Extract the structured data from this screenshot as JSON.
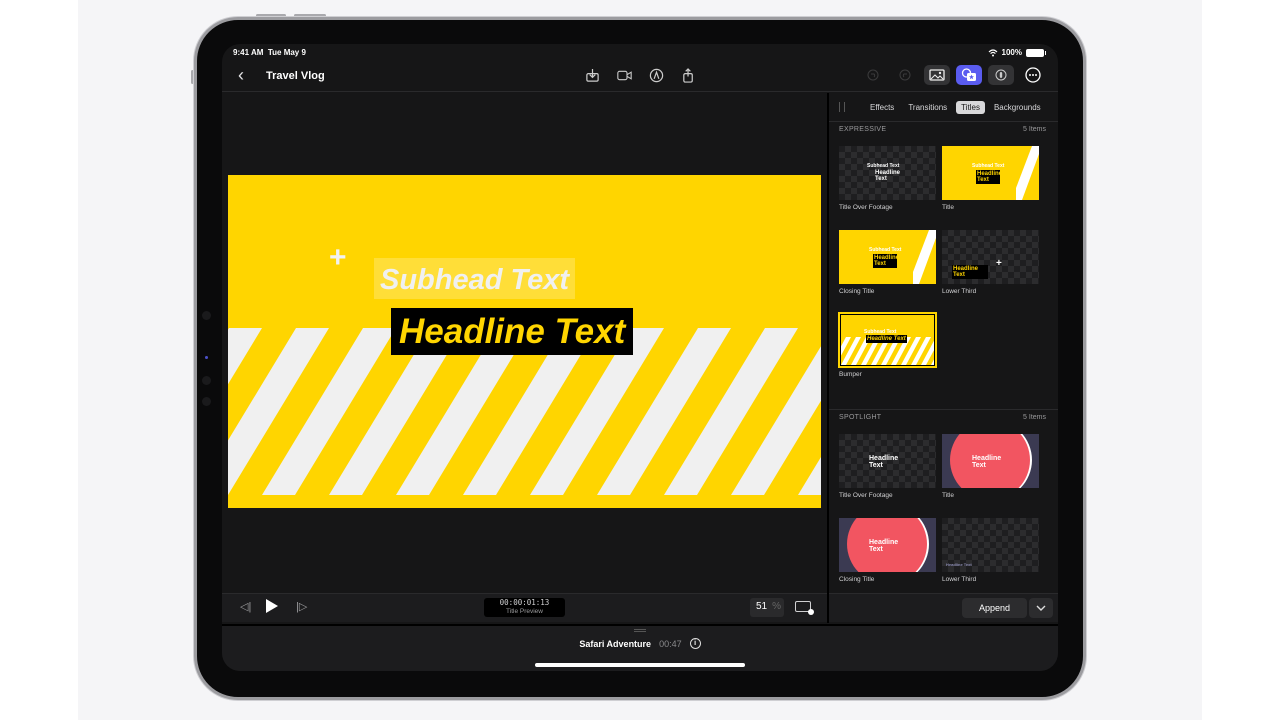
{
  "status_bar": {
    "time": "9:41 AM",
    "date": "Tue May 9",
    "battery": "100%"
  },
  "navbar": {
    "title": "Travel Vlog",
    "center_icons": [
      "import-icon",
      "camera-icon",
      "voiceover-icon",
      "share-icon"
    ],
    "right_icons": [
      "undo-icon",
      "redo-icon",
      "photos-icon",
      "titles-effects-icon",
      "inspector-icon",
      "more-icon"
    ]
  },
  "viewer": {
    "subhead": "Subhead Text",
    "headline": "Headline Text",
    "plus": "+",
    "colors": {
      "background": "#ffd500",
      "stripes": "#f0f0f0",
      "headline_box": "#000000"
    }
  },
  "transport": {
    "timecode": "00:00:01:13",
    "timecode_label": "Title Preview",
    "zoom": "51",
    "zoom_unit": "%"
  },
  "browser": {
    "tabs": [
      {
        "label": "Effects",
        "active": false
      },
      {
        "label": "Transitions",
        "active": false
      },
      {
        "label": "Titles",
        "active": true
      },
      {
        "label": "Backgrounds",
        "active": false
      }
    ],
    "sections": [
      {
        "name": "EXPRESSIVE",
        "count": "5 Items",
        "items": [
          {
            "label": "Title Over Footage"
          },
          {
            "label": "Title"
          },
          {
            "label": "Closing Title"
          },
          {
            "label": "Lower Third"
          },
          {
            "label": "Bumper",
            "selected": true
          }
        ]
      },
      {
        "name": "SPOTLIGHT",
        "count": "5 Items",
        "items": [
          {
            "label": "Title Over Footage"
          },
          {
            "label": "Title"
          },
          {
            "label": "Closing Title"
          },
          {
            "label": "Lower Third"
          }
        ]
      }
    ],
    "thumb_text": {
      "sub": "Subhead Text",
      "head": "Headline Text",
      "head2": "Headline",
      "text": "Text"
    },
    "append_label": "Append"
  },
  "timeline": {
    "project": "Safari Adventure",
    "duration": "00:47"
  }
}
